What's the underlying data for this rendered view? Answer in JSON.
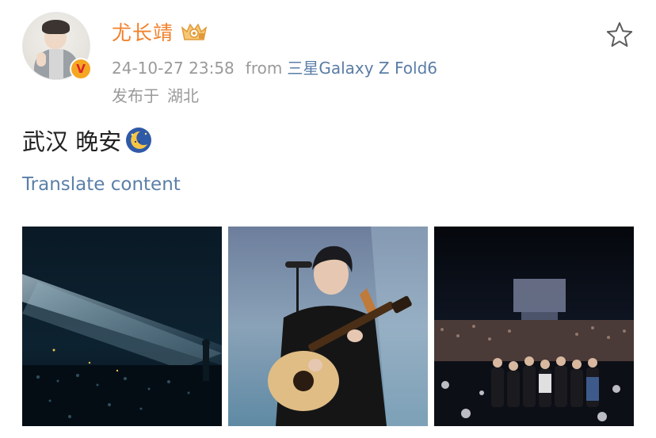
{
  "post": {
    "author": {
      "name": "尤长靖",
      "verified_badge": "V",
      "avatar_icon": "avatar",
      "rank_icon": "crown-icon"
    },
    "meta": {
      "timestamp": "24-10-27 23:58",
      "from_label": "from",
      "device": "三星Galaxy Z Fold6",
      "location_prefix": "发布于",
      "location": "湖北"
    },
    "content": {
      "text": "武汉 晚安",
      "emoji_icon": "moon-icon"
    },
    "translate_label": "Translate content",
    "favorite_icon": "star-icon",
    "photos": [
      {
        "name": "concert-crowd-photo"
      },
      {
        "name": "singer-guitar-photo"
      },
      {
        "name": "stage-group-photo"
      }
    ]
  },
  "colors": {
    "username": "#f2812d",
    "meta": "#9a9a9a",
    "link": "#5b7fa8",
    "device": "#5a7da6",
    "text": "#222222"
  }
}
